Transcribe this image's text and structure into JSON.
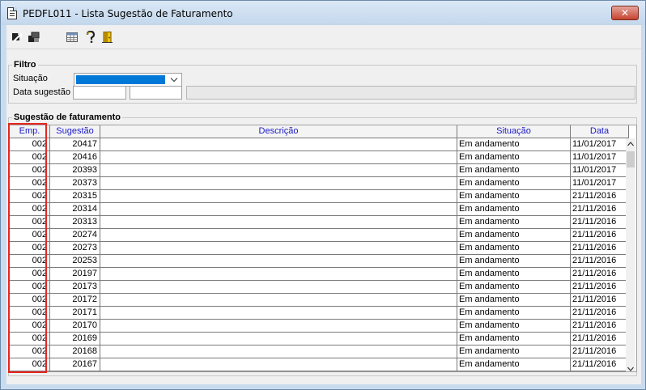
{
  "window": {
    "title": "PEDFL011 - Lista Sugestão de Faturamento",
    "close_label": "✕"
  },
  "toolbar": {
    "buttons": [
      "export-icon",
      "multi-window-icon",
      "table-icon",
      "help-icon",
      "exit-door-icon"
    ]
  },
  "filtro": {
    "legend": "Filtro",
    "situacao_label": "Situação",
    "situacao_value": "",
    "data_label": "Data sugestão",
    "data_from": "",
    "data_to": ""
  },
  "sugestao": {
    "legend": "Sugestão de faturamento",
    "columns": [
      "Emp.",
      "Sugestão",
      "Descrição",
      "Situação",
      "Data"
    ],
    "rows": [
      [
        "002",
        "20417",
        "",
        "Em andamento",
        "11/01/2017"
      ],
      [
        "002",
        "20416",
        "",
        "Em andamento",
        "11/01/2017"
      ],
      [
        "002",
        "20393",
        "",
        "Em andamento",
        "11/01/2017"
      ],
      [
        "002",
        "20373",
        "",
        "Em andamento",
        "11/01/2017"
      ],
      [
        "002",
        "20315",
        "",
        "Em andamento",
        "21/11/2016"
      ],
      [
        "002",
        "20314",
        "",
        "Em andamento",
        "21/11/2016"
      ],
      [
        "002",
        "20313",
        "",
        "Em andamento",
        "21/11/2016"
      ],
      [
        "002",
        "20274",
        "",
        "Em andamento",
        "21/11/2016"
      ],
      [
        "002",
        "20273",
        "",
        "Em andamento",
        "21/11/2016"
      ],
      [
        "002",
        "20253",
        "",
        "Em andamento",
        "21/11/2016"
      ],
      [
        "002",
        "20197",
        "",
        "Em andamento",
        "21/11/2016"
      ],
      [
        "002",
        "20173",
        "",
        "Em andamento",
        "21/11/2016"
      ],
      [
        "002",
        "20172",
        "",
        "Em andamento",
        "21/11/2016"
      ],
      [
        "002",
        "20171",
        "",
        "Em andamento",
        "21/11/2016"
      ],
      [
        "002",
        "20170",
        "",
        "Em andamento",
        "21/11/2016"
      ],
      [
        "002",
        "20169",
        "",
        "Em andamento",
        "21/11/2016"
      ],
      [
        "002",
        "20168",
        "",
        "Em andamento",
        "21/11/2016"
      ],
      [
        "002",
        "20167",
        "",
        "Em andamento",
        "21/11/2016"
      ]
    ]
  },
  "colors": {
    "header_text": "#1a1ac8",
    "selection": "#0078d7",
    "highlight_box": "#e8261f",
    "close_button": "#c7432f"
  }
}
